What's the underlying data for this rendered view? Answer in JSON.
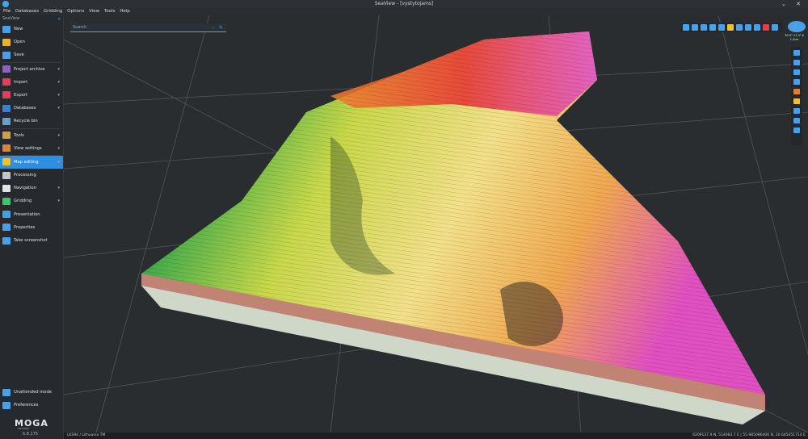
{
  "window": {
    "title": "SeaView - [vystytojams]"
  },
  "menu": [
    "File",
    "Databases",
    "Gridding",
    "Options",
    "View",
    "Tools",
    "Help"
  ],
  "sidebar": {
    "header": "SeaView",
    "items": [
      {
        "label": "New",
        "icon": "new-icon",
        "color": "#4aa0e8",
        "arrow": false
      },
      {
        "label": "Open",
        "icon": "folder-open-icon",
        "color": "#e8b030",
        "arrow": false
      },
      {
        "label": "Save",
        "icon": "save-icon",
        "color": "#4aa0e8",
        "arrow": false
      },
      {
        "label": "Project archive",
        "icon": "archive-icon",
        "color": "#9060c0",
        "arrow": true
      },
      {
        "label": "Import",
        "icon": "import-icon",
        "color": "#e04060",
        "arrow": true
      },
      {
        "label": "Export",
        "icon": "export-icon",
        "color": "#e04060",
        "arrow": true
      },
      {
        "label": "Databases",
        "icon": "database-icon",
        "color": "#3a7fd0",
        "arrow": true
      },
      {
        "label": "Recycle bin",
        "icon": "recycle-bin-icon",
        "color": "#6aa0d0",
        "arrow": false
      },
      {
        "label": "Tools",
        "icon": "tools-icon",
        "color": "#d0a040",
        "arrow": true
      },
      {
        "label": "View settings",
        "icon": "view-settings-icon",
        "color": "#e08030",
        "arrow": true
      },
      {
        "label": "Map editing",
        "icon": "map-editing-icon",
        "color": "#f0c030",
        "arrow": true
      },
      {
        "label": "Processing",
        "icon": "processing-icon",
        "color": "#c0c6cc",
        "arrow": false
      },
      {
        "label": "Navigation",
        "icon": "navigation-icon",
        "color": "#e0e4e8",
        "arrow": true
      },
      {
        "label": "Gridding",
        "icon": "gridding-icon",
        "color": "#40c070",
        "arrow": true
      },
      {
        "label": "Presentation",
        "icon": "presentation-icon",
        "color": "#40a0e0",
        "arrow": false
      },
      {
        "label": "Properties",
        "icon": "properties-icon",
        "color": "#4aa0e8",
        "arrow": false
      },
      {
        "label": "Take screenshot",
        "icon": "screenshot-icon",
        "color": "#4aa0e8",
        "arrow": false
      }
    ],
    "bottom": [
      {
        "label": "Unattended mode",
        "icon": "cloud-icon",
        "color": "#4aa0e8"
      },
      {
        "label": "Preferences",
        "icon": "gear-icon",
        "color": "#4aa0e8"
      }
    ],
    "logo": "MOGA",
    "logo_sub": "SOFTWARE",
    "version": "6.8.175"
  },
  "search": {
    "placeholder": "Search"
  },
  "compass_label": "30.3° 11.3° 6 2.3cm",
  "status": {
    "left": "LKS94 / Lithuania TM",
    "right": "6209137.9 N, 514083.7 E  |  55.985086406 N, 20.645451714 E"
  },
  "colors": {
    "accent": "#2f8ee0",
    "background": "#2a2d30",
    "sidebar": "#262a2f"
  }
}
